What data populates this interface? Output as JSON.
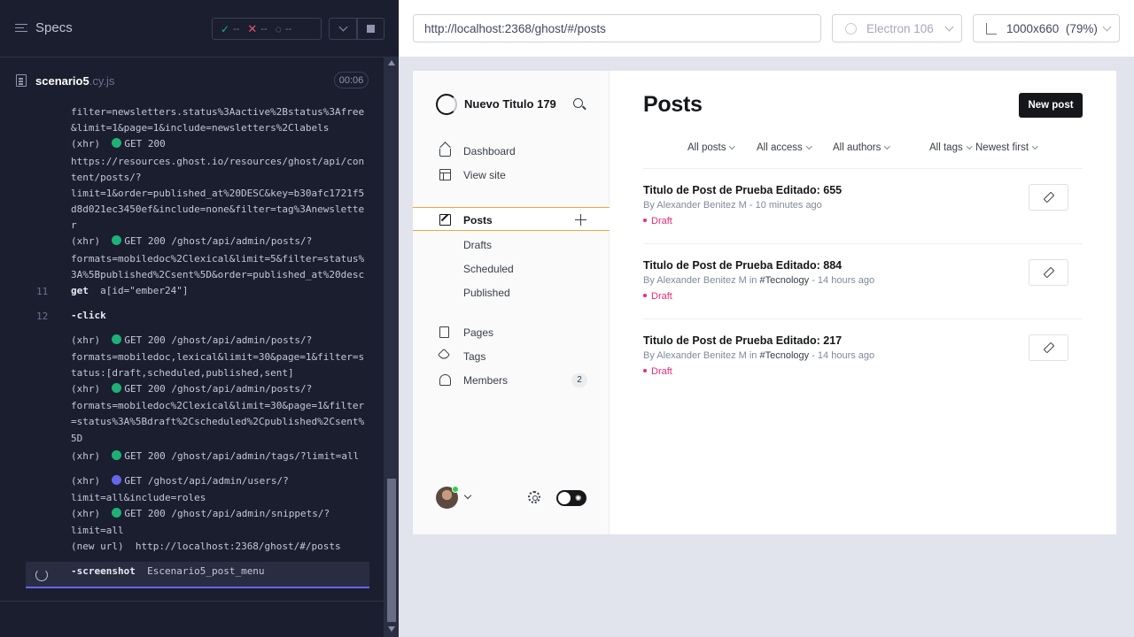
{
  "reporter": {
    "specs_label": "Specs",
    "stats": {
      "passed": "--",
      "failed": "--",
      "pending": "--"
    },
    "spec_file": {
      "name": "scenario5",
      "ext": ".cy.js",
      "duration": "00:06"
    },
    "commands": [
      {
        "text": "filter=newsletters.status%3Aactive%2Bstatus%3Afree"
      },
      {
        "text": "&limit=1&page=1&include=newsletters%2Clabels"
      },
      {
        "prefix": "(xhr)  ",
        "dot": "green",
        "text": "GET 200"
      },
      {
        "text": "https://resources.ghost.io/resources/ghost/api/con"
      },
      {
        "text": "tent/posts/?"
      },
      {
        "text": "limit=1&order=published_at%20DESC&key=b30afc1721f5"
      },
      {
        "text": "d8d021ec3450ef&include=none&filter=tag%3Anewslette"
      },
      {
        "text": "r"
      },
      {
        "prefix": "(xhr)  ",
        "dot": "green",
        "text": "GET 200 /ghost/api/admin/posts/?"
      },
      {
        "text": "formats=mobiledoc%2Clexical&limit=5&filter=status%"
      },
      {
        "text": "3A%5Bpublished%2Csent%5D&order=published_at%20desc"
      },
      {
        "bold": "get",
        "text": "  a[id=\"ember24\"]"
      },
      {
        "bold": "-click",
        "text": ""
      },
      {
        "prefix": "(xhr)  ",
        "dot": "green",
        "text": "GET 200 /ghost/api/admin/posts/?"
      },
      {
        "text": "formats=mobiledoc,lexical&limit=30&page=1&filter=s"
      },
      {
        "text": "tatus:[draft,scheduled,published,sent]"
      },
      {
        "prefix": "(xhr)  ",
        "dot": "green",
        "text": "GET 200 /ghost/api/admin/posts/?"
      },
      {
        "text": "formats=mobiledoc%2Clexical&limit=30&page=1&filter"
      },
      {
        "text": "=status%3A%5Bdraft%2Cscheduled%2Cpublished%2Csent%"
      },
      {
        "text": "5D"
      },
      {
        "prefix": "(xhr)  ",
        "dot": "green",
        "text": "GET 200 /ghost/api/admin/tags/?limit=all"
      },
      {
        "prefix": "(xhr)  ",
        "dot": "blue",
        "text": "GET /ghost/api/admin/users/?"
      },
      {
        "text": "limit=all&include=roles"
      },
      {
        "prefix": "(xhr)  ",
        "dot": "green",
        "text": "GET 200 /ghost/api/admin/snippets/?"
      },
      {
        "text": "limit=all"
      },
      {
        "prefix": "(new url)  ",
        "text": "http://localhost:2368/ghost/#/posts"
      },
      {
        "bold": "-screenshot",
        "text": "  Escenario5_post_menu"
      }
    ],
    "line_numbers": [
      "11",
      "12"
    ]
  },
  "aut": {
    "url": "http://localhost:2368/ghost/#/posts",
    "browser": "Electron 106",
    "viewport": "1000x660",
    "zoom": "(79%)"
  },
  "ghost": {
    "site_name": "Nuevo Titulo 179",
    "nav": {
      "dashboard": "Dashboard",
      "view_site": "View site",
      "posts": "Posts",
      "drafts": "Drafts",
      "scheduled": "Scheduled",
      "published": "Published",
      "pages": "Pages",
      "tags": "Tags",
      "members": "Members",
      "members_count": "2"
    },
    "page_title": "Posts",
    "new_post": "New post",
    "filters": [
      "All posts",
      "All access",
      "All authors",
      "All tags",
      "Newest first"
    ],
    "posts": [
      {
        "title": "Titulo de Post de Prueba Editado: 655",
        "author": "By Alexander Benitez M",
        "tag": "",
        "time": "10 minutes ago",
        "status": "Draft"
      },
      {
        "title": "Titulo de Post de Prueba Editado: 884",
        "author": "By Alexander Benitez M",
        "tag": "#Tecnology",
        "time": "14 hours ago",
        "status": "Draft"
      },
      {
        "title": "Titulo de Post de Prueba Editado: 217",
        "author": "By Alexander Benitez M",
        "tag": "#Tecnology",
        "time": "14 hours ago",
        "status": "Draft"
      }
    ]
  },
  "colors": {
    "reporter_bg": "#1b1e2e",
    "pass": "#1fb076",
    "fail": "#e45770",
    "accent": "#6566e8",
    "ghost_active_border": "#f0a63c",
    "draft": "#e82a7a"
  }
}
